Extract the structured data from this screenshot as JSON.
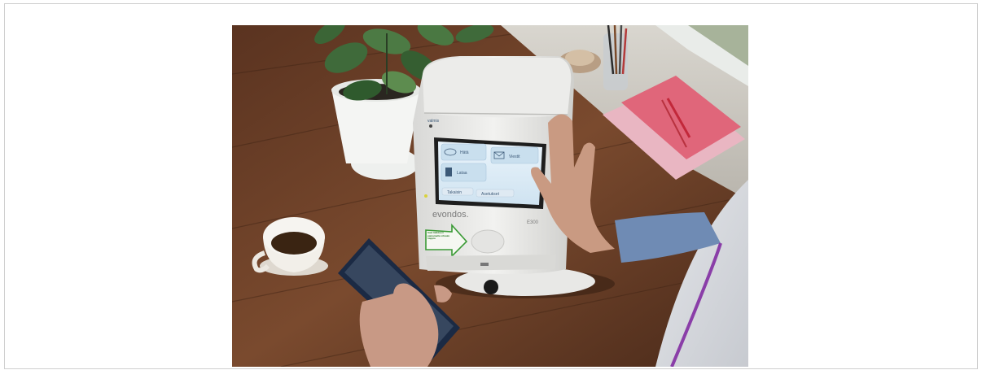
{
  "device": {
    "brand": "evondos.",
    "model": "E300",
    "indicator_label": "valmis",
    "screen": {
      "buttons": [
        "Hätä",
        "Viestit",
        "Lataa"
      ],
      "bottom_buttons": [
        "Takaisin",
        "Asetukset"
      ]
    },
    "sticker_text": "Saat lääkkeen painamalla vihreää nappia"
  }
}
